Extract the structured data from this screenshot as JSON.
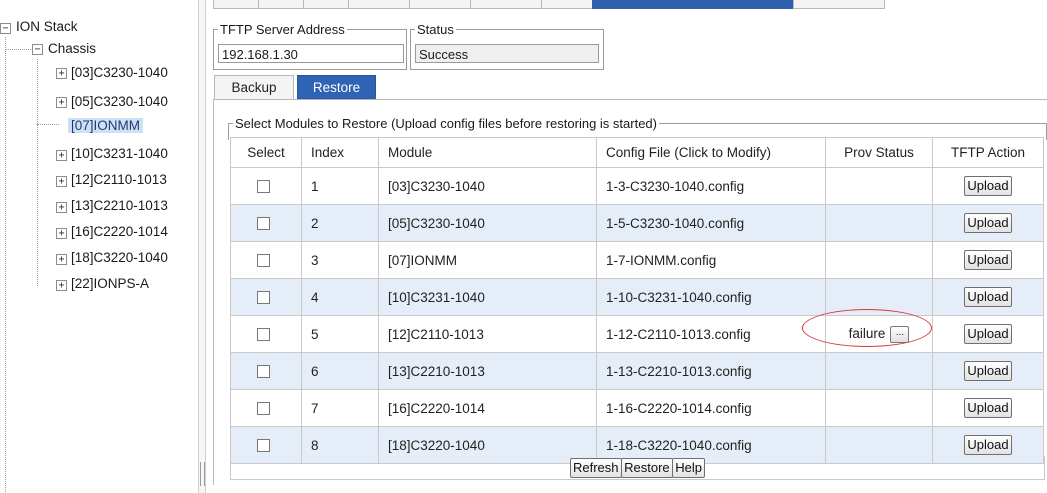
{
  "tree": {
    "root": "ION Stack",
    "chassis": "Chassis",
    "items": [
      {
        "label": "[03]C3230-1040",
        "expandable": true
      },
      {
        "label": "[05]C3230-1040",
        "expandable": true
      },
      {
        "label": "[07]IONMM",
        "expandable": false,
        "selected": true
      },
      {
        "label": "[10]C3231-1040",
        "expandable": true
      },
      {
        "label": "[12]C2110-1013",
        "expandable": true
      },
      {
        "label": "[13]C2210-1013",
        "expandable": true
      },
      {
        "label": "[16]C2220-1014",
        "expandable": true
      },
      {
        "label": "[18]C3220-1040",
        "expandable": true
      },
      {
        "label": "[22]IONPS-A",
        "expandable": true
      }
    ],
    "expand_glyph": "+",
    "collapse_glyph": "−"
  },
  "tftp": {
    "server_legend": "TFTP Server Address",
    "server_value": "192.168.1.30",
    "status_legend": "Status",
    "status_value": "Success"
  },
  "subtabs": [
    "Backup",
    "Restore"
  ],
  "table": {
    "legend": "Select Modules to Restore (Upload config files before restoring is started)",
    "headers": [
      "Select",
      "Index",
      "Module",
      "Config File (Click to Modify)",
      "Prov Status",
      "TFTP Action"
    ],
    "rows": [
      {
        "index": "1",
        "module": "[03]C3230-1040",
        "config": "1-3-C3230-1040.config",
        "prov": "",
        "action": "Upload"
      },
      {
        "index": "2",
        "module": "[05]C3230-1040",
        "config": "1-5-C3230-1040.config",
        "prov": "",
        "action": "Upload"
      },
      {
        "index": "3",
        "module": "[07]IONMM",
        "config": "1-7-IONMM.config",
        "prov": "",
        "action": "Upload"
      },
      {
        "index": "4",
        "module": "[10]C3231-1040",
        "config": "1-10-C3231-1040.config",
        "prov": "",
        "action": "Upload"
      },
      {
        "index": "5",
        "module": "[12]C2110-1013",
        "config": "1-12-C2110-1013.config",
        "prov": "failure",
        "prov_button": "...",
        "action": "Upload"
      },
      {
        "index": "6",
        "module": "[13]C2210-1013",
        "config": "1-13-C2210-1013.config",
        "prov": "",
        "action": "Upload"
      },
      {
        "index": "7",
        "module": "[16]C2220-1014",
        "config": "1-16-C2220-1014.config",
        "prov": "",
        "action": "Upload"
      },
      {
        "index": "8",
        "module": "[18]C3220-1040",
        "config": "1-18-C3220-1040.config",
        "prov": "",
        "action": "Upload"
      }
    ]
  },
  "buttons": {
    "refresh": "Refresh",
    "restore": "Restore",
    "help": "Help"
  },
  "colors": {
    "active_tab": "#2f63b3",
    "even_row": "#e5eef8",
    "selected_tree_item": "#cfe0f5",
    "annotation": "#d53a3a"
  }
}
